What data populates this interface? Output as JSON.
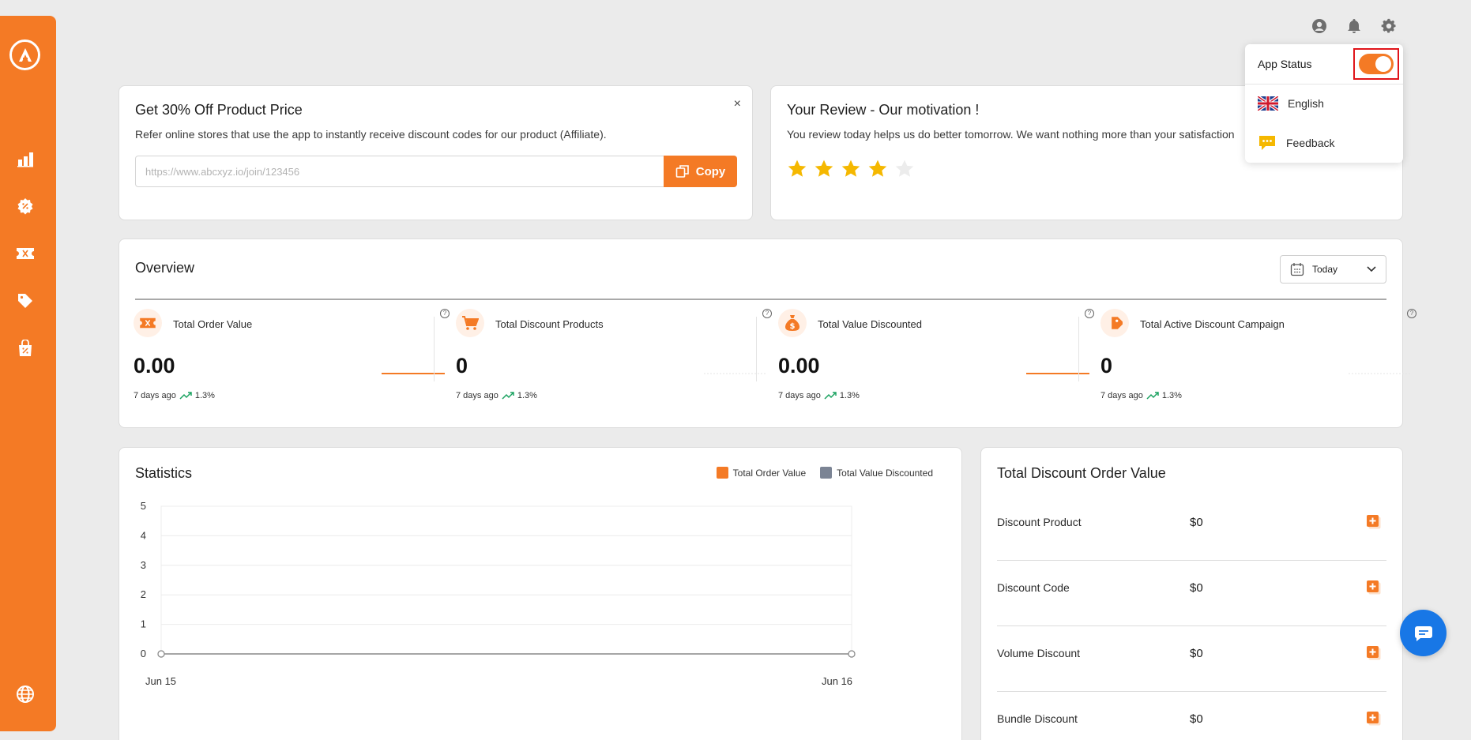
{
  "affiliate": {
    "title": "Get 30% Off Product Price",
    "subtitle": "Refer online stores that use the app to instantly receive discount codes for our product (Affiliate).",
    "placeholder": "https://www.abcxyz.io/join/123456",
    "copy_label": "Copy",
    "close_glyph": "×"
  },
  "review": {
    "title": "Your Review - Our motivation !",
    "subtitle": "You review today helps us do better tomorrow. We want nothing more than your satisfaction",
    "rating": 4,
    "max_rating": 5
  },
  "overview": {
    "title": "Overview",
    "date_filter": "Today",
    "metrics": [
      {
        "label": "Total Order Value",
        "value": "0.00",
        "period": "7 days ago",
        "change": "1.3%",
        "icon": "ticket-icon"
      },
      {
        "label": "Total Discount Products",
        "value": "0",
        "period": "7 days ago",
        "change": "1.3%",
        "icon": "cart-icon"
      },
      {
        "label": "Total Value Discounted",
        "value": "0.00",
        "period": "7 days ago",
        "change": "1.3%",
        "icon": "money-bag-icon"
      },
      {
        "label": "Total Active Discount Campaign",
        "value": "0",
        "period": "7 days ago",
        "change": "1.3%",
        "icon": "tag-icon"
      }
    ]
  },
  "statistics": {
    "title": "Statistics",
    "legend": [
      "Total Order Value",
      "Total Value Discounted"
    ]
  },
  "chart_data": {
    "type": "line",
    "title": "Statistics",
    "x": [
      "Jun 15",
      "Jun 16"
    ],
    "y_ticks": [
      0,
      1,
      2,
      3,
      4,
      5
    ],
    "ylim": [
      0,
      5
    ],
    "series": [
      {
        "name": "Total Order Value",
        "values": [
          0,
          0
        ],
        "color": "#f47a25"
      },
      {
        "name": "Total Value Discounted",
        "values": [
          0,
          0
        ],
        "color": "#7b8494"
      }
    ],
    "grid": true,
    "legend": "top-right"
  },
  "discount_order": {
    "title": "Total Discount Order Value",
    "rows": [
      {
        "name": "Discount Product",
        "value": "$0"
      },
      {
        "name": "Discount Code",
        "value": "$0"
      },
      {
        "name": "Volume Discount",
        "value": "$0"
      },
      {
        "name": "Bundle Discount",
        "value": "$0"
      }
    ]
  },
  "menu": {
    "app_status_label": "App Status",
    "app_status_on": true,
    "language": "English",
    "feedback": "Feedback"
  },
  "colors": {
    "accent": "#f47a25",
    "series2": "#7b8494",
    "chat": "#1877e6",
    "trend_up": "#1aa260"
  }
}
